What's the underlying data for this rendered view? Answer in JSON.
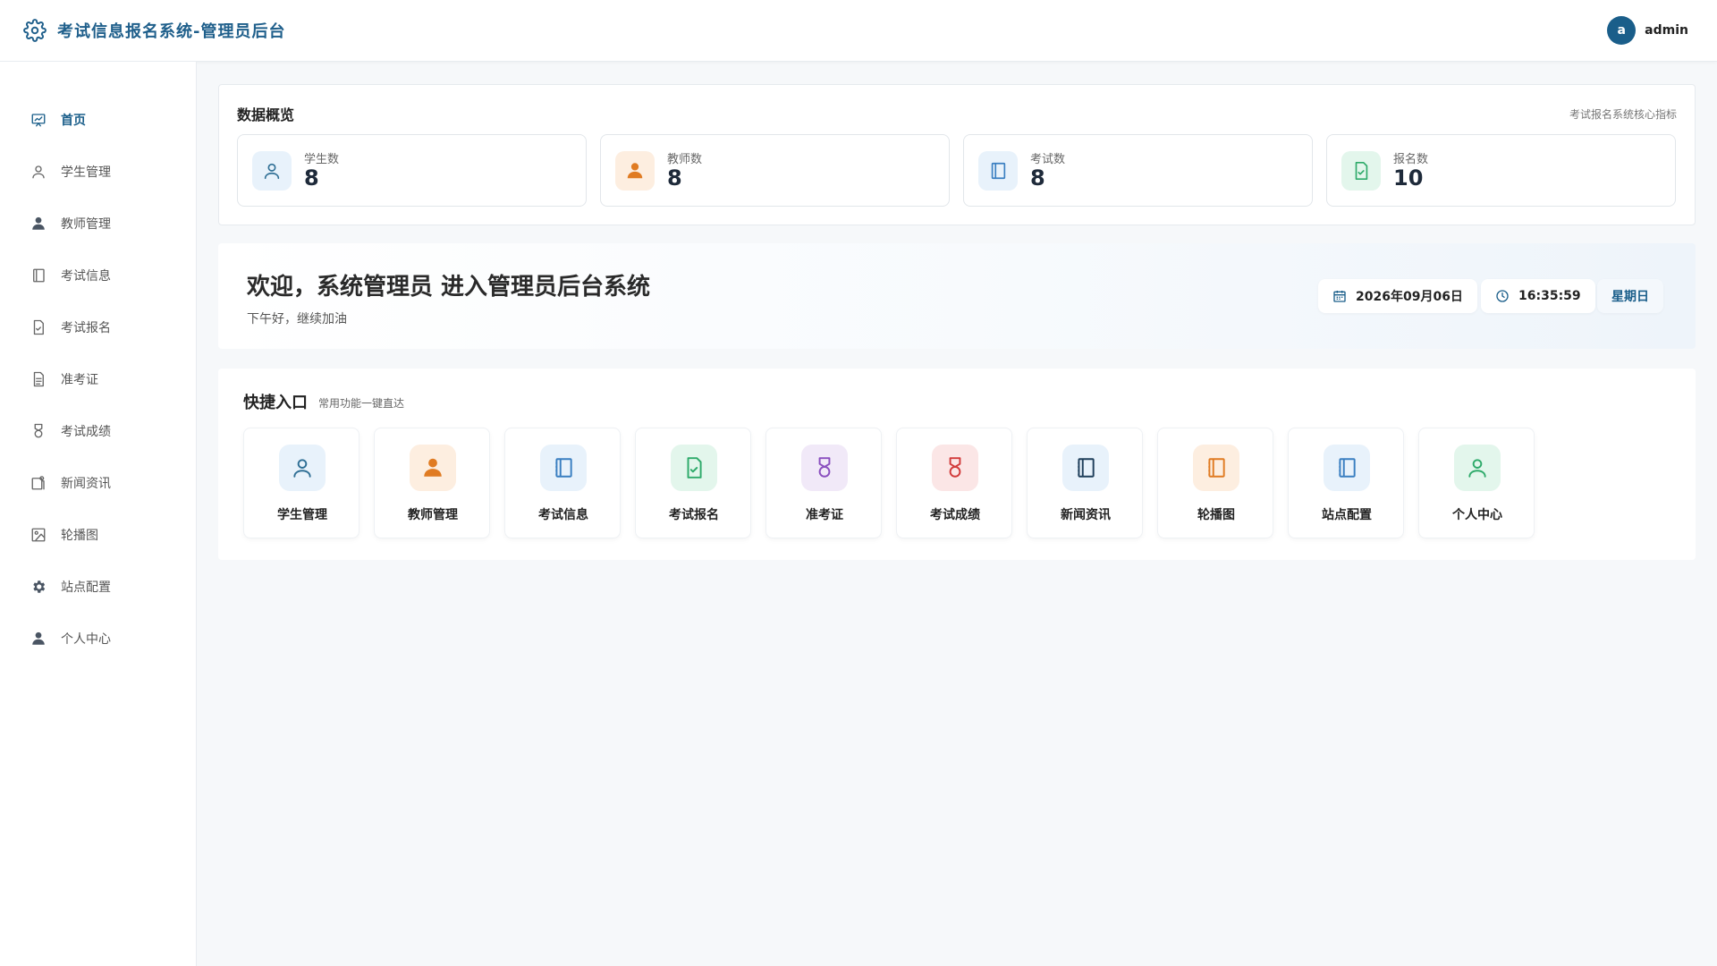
{
  "header": {
    "app_title": "考试信息报名系统-管理员后台",
    "avatar_letter": "a",
    "username": "admin"
  },
  "sidebar": {
    "items": [
      {
        "label": "首页",
        "icon": "dashboard-icon",
        "active": true
      },
      {
        "label": "学生管理",
        "icon": "user-icon"
      },
      {
        "label": "教师管理",
        "icon": "teacher-icon"
      },
      {
        "label": "考试信息",
        "icon": "notebook-icon"
      },
      {
        "label": "考试报名",
        "icon": "document-check-icon"
      },
      {
        "label": "准考证",
        "icon": "document-icon"
      },
      {
        "label": "考试成绩",
        "icon": "medal-icon"
      },
      {
        "label": "新闻资讯",
        "icon": "news-icon"
      },
      {
        "label": "轮播图",
        "icon": "picture-icon"
      },
      {
        "label": "站点配置",
        "icon": "gear-icon"
      },
      {
        "label": "个人中心",
        "icon": "user-filled-icon"
      }
    ]
  },
  "overview": {
    "title": "数据概览",
    "subtitle": "考试报名系统核心指标",
    "stats": [
      {
        "label": "学生数",
        "value": "8",
        "icon": "user-icon",
        "color": "#2f6f95"
      },
      {
        "label": "教师数",
        "value": "8",
        "icon": "teacher-icon",
        "color": "#e07b22"
      },
      {
        "label": "考试数",
        "value": "8",
        "icon": "notebook-icon",
        "color": "#3a7fc1"
      },
      {
        "label": "报名数",
        "value": "10",
        "icon": "document-check-icon",
        "color": "#2eaa6a"
      }
    ]
  },
  "welcome": {
    "title": "欢迎，系统管理员 进入管理员后台系统",
    "subtitle": "下午好，继续加油",
    "date": "2026年09月06日",
    "time": "16:35:59",
    "weekday": "星期日"
  },
  "quick": {
    "title": "快捷入口",
    "subtitle": "常用功能一键直达",
    "items": [
      {
        "label": "学生管理",
        "icon": "user-icon",
        "color": "#2f6f95"
      },
      {
        "label": "教师管理",
        "icon": "teacher-icon",
        "color": "#e07b22"
      },
      {
        "label": "考试信息",
        "icon": "notebook-icon",
        "color": "#3a7fc1"
      },
      {
        "label": "考试报名",
        "icon": "document-check-icon",
        "color": "#2eaa6a"
      },
      {
        "label": "准考证",
        "icon": "medal-icon",
        "color": "#8a4fbf"
      },
      {
        "label": "考试成绩",
        "icon": "medal-icon",
        "color": "#d23b3b"
      },
      {
        "label": "新闻资讯",
        "icon": "notebook-icon",
        "color": "#1f5f8b"
      },
      {
        "label": "轮播图",
        "icon": "notebook-icon",
        "color": "#e07b22"
      },
      {
        "label": "站点配置",
        "icon": "notebook-icon",
        "color": "#3a7fc1"
      },
      {
        "label": "个人中心",
        "icon": "user-icon",
        "color": "#2eaa6a"
      }
    ]
  }
}
